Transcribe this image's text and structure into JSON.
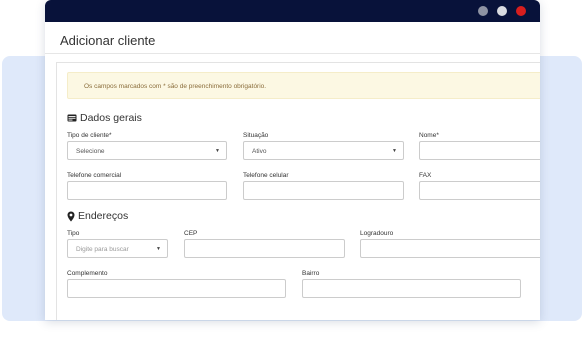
{
  "window": {
    "title": "Adicionar cliente",
    "dots": [
      "#8e93a3",
      "#d9dbe1",
      "#d81e1e"
    ]
  },
  "notice": "Os campos marcados com * são de preenchimento obrigatório.",
  "dados_gerais": {
    "heading": "Dados gerais",
    "tipo_cliente": {
      "label": "Tipo de cliente*",
      "value": "Selecione"
    },
    "situacao": {
      "label": "Situação",
      "value": "Ativo"
    },
    "nome": {
      "label": "Nome*",
      "value": ""
    },
    "telefone_comercial": {
      "label": "Telefone comercial",
      "value": ""
    },
    "telefone_celular": {
      "label": "Telefone celular",
      "value": ""
    },
    "fax": {
      "label": "FAX",
      "value": ""
    }
  },
  "enderecos": {
    "heading": "Endereços",
    "tipo": {
      "label": "Tipo",
      "placeholder": "Digite para buscar"
    },
    "cep": {
      "label": "CEP",
      "value": ""
    },
    "logradouro": {
      "label": "Logradouro",
      "value": ""
    },
    "complemento": {
      "label": "Complemento",
      "value": ""
    },
    "bairro": {
      "label": "Bairro",
      "value": ""
    }
  }
}
